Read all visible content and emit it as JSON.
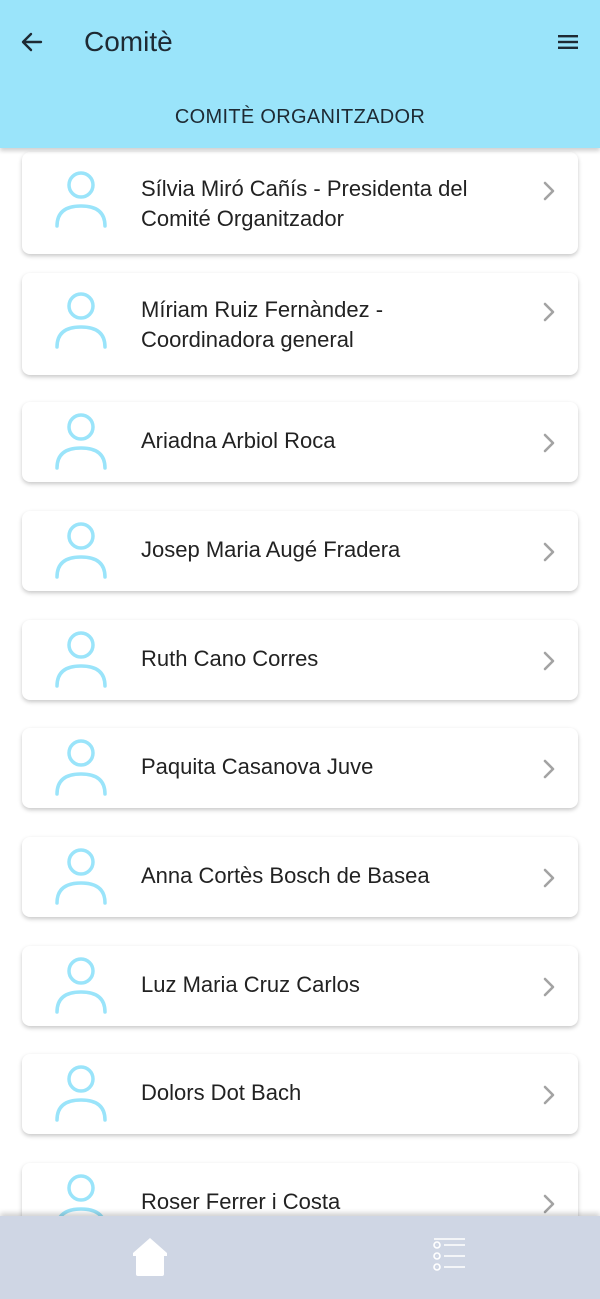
{
  "header": {
    "title": "Comitè",
    "section_title": "COMITÈ ORGANITZADOR",
    "back_icon": "arrow-left-icon",
    "menu_icon": "hamburger-menu-icon"
  },
  "members": [
    {
      "name": "Sílvia Miró Cañís - Presidenta del Comité Organitzador"
    },
    {
      "name": "Míriam Ruiz Fernàndez - Coordinadora general"
    },
    {
      "name": "Ariadna Arbiol Roca"
    },
    {
      "name": "Josep Maria Augé Fradera"
    },
    {
      "name": "Ruth Cano Corres"
    },
    {
      "name": "Paquita Casanova Juve"
    },
    {
      "name": "Anna Cortès Bosch de Basea"
    },
    {
      "name": "Luz Maria Cruz Carlos"
    },
    {
      "name": "Dolors Dot Bach"
    },
    {
      "name": "Roser Ferrer i Costa"
    }
  ],
  "bottom_nav": {
    "home_icon": "home-icon",
    "list_icon": "list-icon"
  },
  "colors": {
    "header_bg": "#9ae4fa",
    "avatar": "#9ae4fa",
    "chevron": "#a3a3a3",
    "bottom_nav_bg": "#cfd6e4",
    "nav_icon": "#ffffff"
  }
}
